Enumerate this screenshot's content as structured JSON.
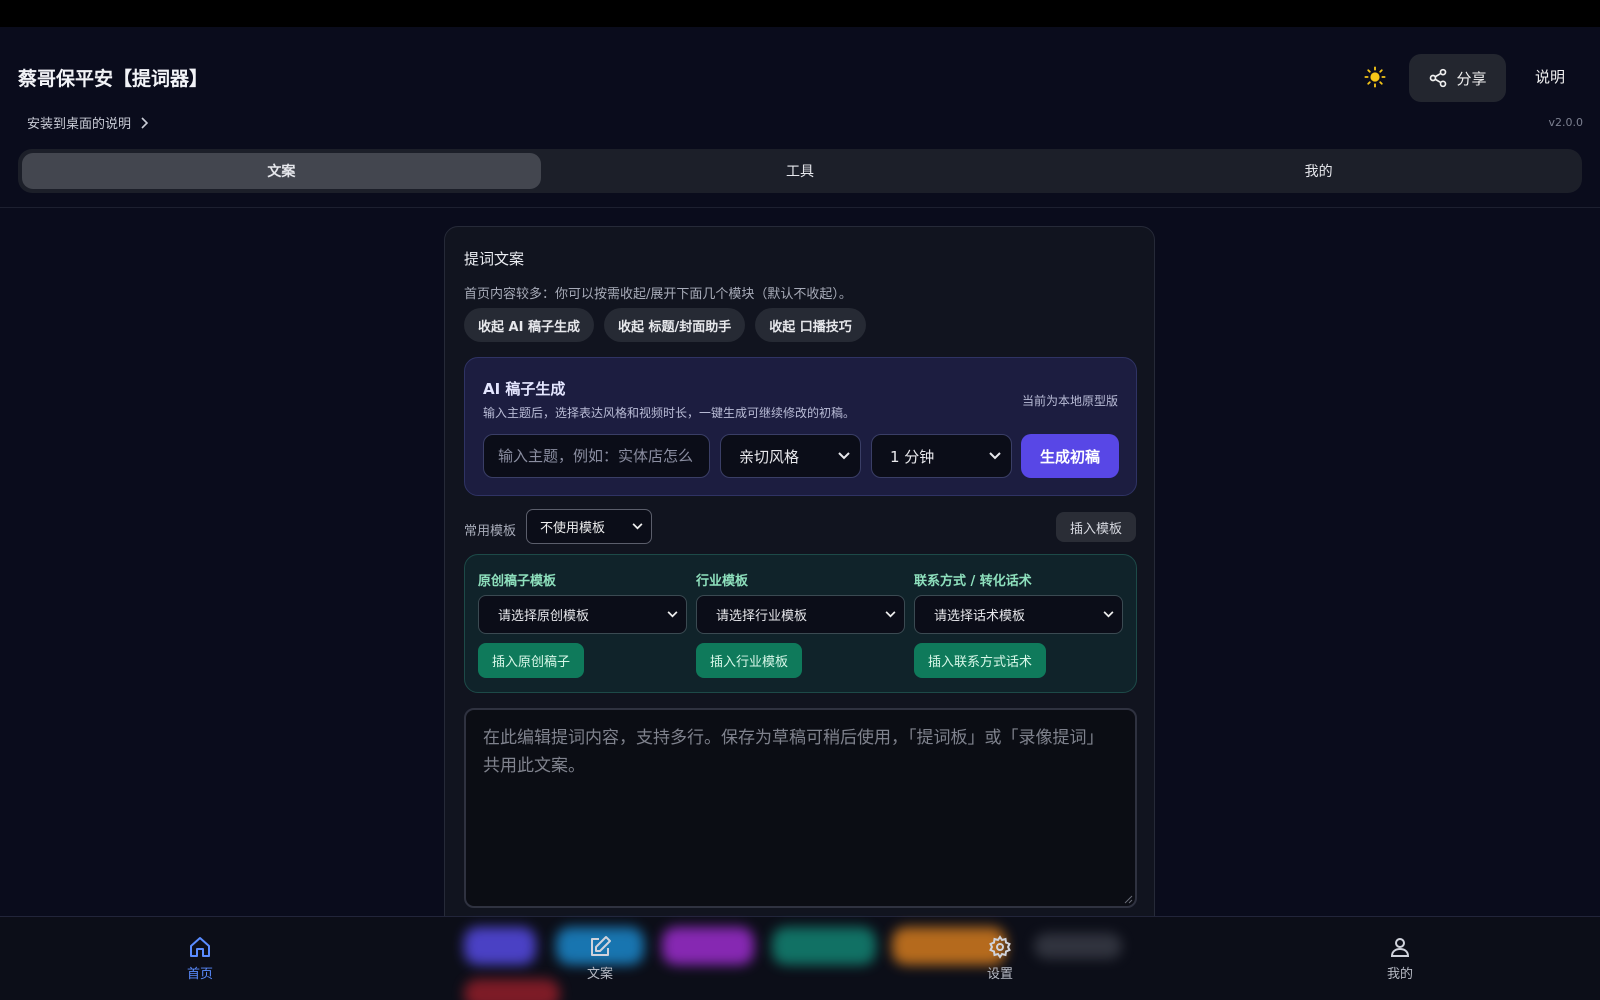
{
  "app": {
    "title": "蔡哥保平安【提词器】",
    "share_label": "分享",
    "help_label": "说明",
    "install_link": "安装到桌面的说明",
    "version": "v2.0.0"
  },
  "tabs": [
    {
      "label": "文案",
      "active": true
    },
    {
      "label": "工具",
      "active": false
    },
    {
      "label": "我的",
      "active": false
    }
  ],
  "card": {
    "title": "提词文案",
    "hint": "首页内容较多：你可以按需收起/展开下面几个模块（默认不收起）。",
    "pills": [
      "收起 AI 稿子生成",
      "收起 标题/封面助手",
      "收起 口播技巧"
    ]
  },
  "ai": {
    "title": "AI 稿子生成",
    "desc": "输入主题后，选择表达风格和视频时长，一键生成可继续修改的初稿。",
    "proto_note": "当前为本地原型版",
    "topic_placeholder": "输入主题，例如：实体店怎么",
    "style_value": "亲切风格",
    "duration_value": "1 分钟",
    "generate_label": "生成初稿"
  },
  "templates": {
    "label": "常用模板",
    "selected": "不使用模板",
    "insert_label": "插入模板",
    "columns": [
      {
        "title": "原创稿子模板",
        "select": "请选择原创模板",
        "button": "插入原创稿子"
      },
      {
        "title": "行业模板",
        "select": "请选择行业模板",
        "button": "插入行业模板"
      },
      {
        "title": "联系方式 / 转化话术",
        "select": "请选择话术模板",
        "button": "插入联系方式话术"
      }
    ]
  },
  "editor": {
    "placeholder": "在此编辑提词内容，支持多行。保存为草稿可稍后使用，「提词板」或「录像提词」共用此文案。"
  },
  "bottom_nav": [
    {
      "label": "首页",
      "icon": "home-icon",
      "active": true
    },
    {
      "label": "文案",
      "icon": "edit-icon",
      "active": false
    },
    {
      "label": "设置",
      "icon": "gear-icon",
      "active": false
    },
    {
      "label": "我的",
      "icon": "user-icon",
      "active": false
    }
  ],
  "colors": {
    "background": "#0a0c1c",
    "accent": "#5847e6",
    "green_button": "#0f7a5b",
    "nav_active": "#5a8cff",
    "sun": "#f5c518"
  }
}
